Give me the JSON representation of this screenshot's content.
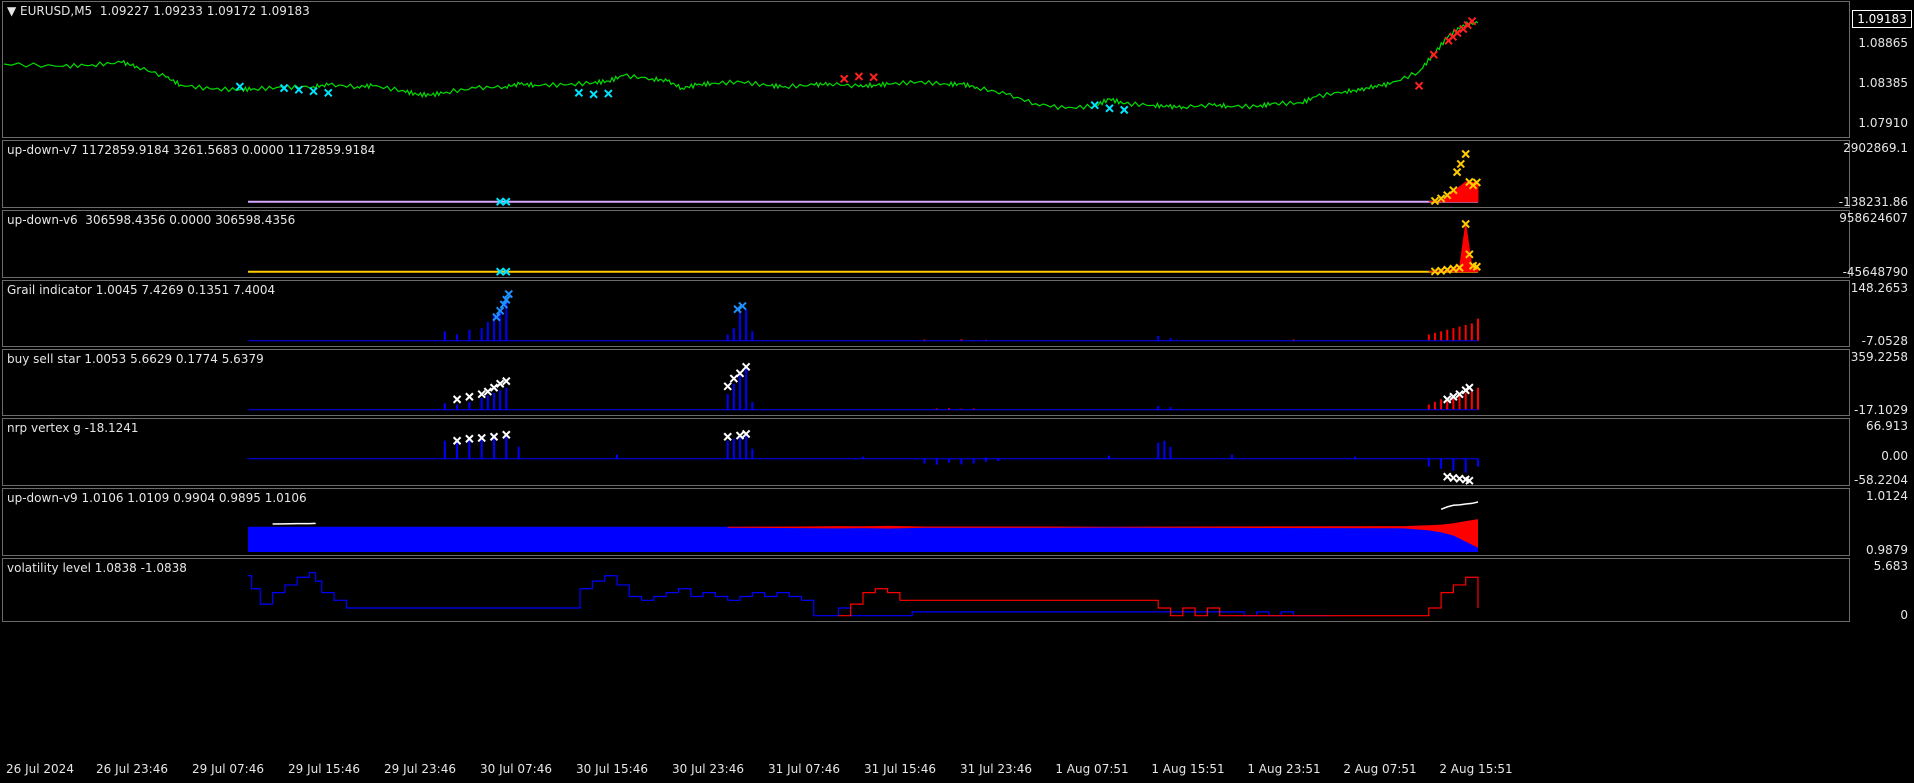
{
  "chart_data": [
    {
      "type": "line",
      "title": "EURUSD,M5  1.09227 1.09233 1.09172 1.09183",
      "symbol": "EURUSD",
      "timeframe": "M5",
      "ohlc": {
        "open": 1.09227,
        "high": 1.09233,
        "low": 1.09172,
        "close": 1.09183
      },
      "current_price": "1.09183",
      "price_ticks": [
        "1.09183",
        "1.08865",
        "1.08385",
        "1.07910"
      ],
      "ylim": [
        1.0775,
        1.0928
      ],
      "series": [
        {
          "name": "price",
          "color": "#00e000",
          "x": [
            0,
            4,
            6,
            8,
            9,
            11,
            12,
            14,
            16,
            17,
            19,
            21,
            22,
            24,
            25,
            27,
            28,
            29,
            30,
            32,
            34,
            35,
            36,
            38,
            40,
            41,
            42,
            44,
            45,
            46,
            47,
            48,
            50,
            52,
            53,
            55,
            56,
            58,
            59,
            60,
            62,
            64,
            65,
            66,
            68,
            70,
            72,
            74,
            75,
            76,
            78,
            79,
            80,
            82,
            83,
            85,
            86,
            88,
            89,
            91,
            92,
            93,
            94,
            96,
            97,
            98,
            99,
            100
          ],
          "y": [
            1.0865,
            1.0862,
            1.0864,
            1.0867,
            1.0862,
            1.0848,
            1.0838,
            1.0833,
            1.0832,
            1.0833,
            1.0835,
            1.0836,
            1.0838,
            1.0836,
            1.0837,
            1.0831,
            1.0826,
            1.0825,
            1.0829,
            1.0834,
            1.0836,
            1.0839,
            1.0838,
            1.0838,
            1.0841,
            1.0843,
            1.085,
            1.0846,
            1.0843,
            1.0834,
            1.0838,
            1.084,
            1.0842,
            1.0837,
            1.0836,
            1.0838,
            1.084,
            1.0836,
            1.0838,
            1.0839,
            1.0842,
            1.0839,
            1.0839,
            1.0835,
            1.0826,
            1.0814,
            1.0808,
            1.0811,
            1.082,
            1.0814,
            1.0812,
            1.081,
            1.081,
            1.0812,
            1.0811,
            1.081,
            1.0814,
            1.0815,
            1.0823,
            1.083,
            1.0831,
            1.0837,
            1.0839,
            1.0855,
            1.0878,
            1.0901,
            1.0915,
            1.0918
          ]
        }
      ],
      "markers": [
        {
          "color": "#00e5ff",
          "x": [
            16,
            19,
            20,
            21,
            22,
            39,
            40,
            41,
            74,
            75,
            76
          ],
          "y": [
            1.0836,
            1.0834,
            1.0832,
            1.083,
            1.0828,
            1.0828,
            1.0826,
            1.0827,
            1.0812,
            1.0808,
            1.0806
          ]
        },
        {
          "color": "#ff2020",
          "x": [
            57,
            58,
            59,
            96,
            97,
            98,
            98.3,
            98.6,
            99,
            99.3,
            99.6
          ],
          "y": [
            1.0846,
            1.0849,
            1.0848,
            1.0837,
            1.0877,
            1.0895,
            1.09,
            1.0905,
            1.091,
            1.0915,
            1.092
          ]
        }
      ]
    },
    {
      "type": "area",
      "title": "up-down-v7 1172859.9184 3261.5683 0.0000 1172859.9184",
      "scale_top": "2902869.1",
      "scale_bottom": "-138231.86",
      "ylim": [
        -138231.86,
        2902869.1
      ],
      "baseline": {
        "color": "#d8a8ff",
        "value": 0
      },
      "series": [
        {
          "name": "",
          "color": "#ff0000",
          "x": [
            96,
            97,
            97.5,
            98,
            98.5,
            99,
            99.5,
            100
          ],
          "y": [
            0,
            60000,
            250000,
            600000,
            900000,
            1200000,
            1172859.9184,
            1172859.9184
          ]
        }
      ],
      "markers": [
        {
          "color": "#00e5ff",
          "x": [
            20.5,
            21
          ],
          "y": [
            0,
            0
          ]
        },
        {
          "color": "#ffcc00",
          "x": [
            96.5,
            97,
            97.5,
            98,
            98.3,
            98.6,
            99,
            99.3,
            99.6,
            99.9
          ],
          "y": [
            50000,
            200000,
            400000,
            700000,
            1800000,
            2300000,
            2902869.1,
            1200000,
            1000000,
            1172859.9184
          ]
        }
      ]
    },
    {
      "type": "area",
      "title": "up-down-v6  306598.4356 0.0000 306598.4356",
      "scale_top": "958624607",
      "scale_bottom": "-45648790",
      "ylim": [
        -45648790,
        958624607
      ],
      "baseline": {
        "color": "#ffcc00",
        "value": 0
      },
      "series": [
        {
          "name": "",
          "color": "#ff0000",
          "x": [
            96,
            97,
            97.5,
            98,
            98.5,
            99,
            99.5,
            100
          ],
          "y": [
            0,
            10000000,
            30000000,
            60000000,
            80000000,
            958624607,
            100000000,
            80000000
          ]
        }
      ],
      "markers": [
        {
          "color": "#00e5ff",
          "x": [
            20.5,
            21
          ],
          "y": [
            0,
            0
          ]
        },
        {
          "color": "#ffcc00",
          "x": [
            96.5,
            97,
            97.5,
            98,
            98.5,
            99,
            99.3,
            99.6,
            99.9
          ],
          "y": [
            5000000,
            20000000,
            40000000,
            60000000,
            80000000,
            958624607,
            350000000,
            120000000,
            100000000
          ]
        }
      ]
    },
    {
      "type": "bar",
      "title": "Grail indicator 1.0045 7.4269 0.1351 7.4004",
      "scale_top": "148.2653",
      "scale_bottom": "-7.0528",
      "ylim": [
        -7.0528,
        148.2653
      ],
      "series": [
        {
          "name": "",
          "color": "#0000ff",
          "x": [
            16,
            17,
            18,
            19,
            19.5,
            20,
            20.5,
            21,
            39,
            39.5,
            40,
            40.5,
            41,
            74,
            75
          ],
          "y": [
            30,
            20,
            35,
            40,
            60,
            80,
            100,
            120,
            20,
            40,
            90,
            100,
            30,
            15,
            8
          ]
        },
        {
          "name": "",
          "color": "#ff0000",
          "x": [
            55,
            58,
            60,
            85,
            96,
            96.5,
            97,
            97.5,
            98,
            98.5,
            99,
            99.5,
            100
          ],
          "y": [
            4,
            5,
            3,
            4,
            20,
            25,
            30,
            35,
            40,
            45,
            50,
            55,
            70
          ]
        }
      ],
      "markers": [
        {
          "color": "#1e90ff",
          "x": [
            20.2,
            20.5,
            20.8,
            21,
            21.2,
            39.8,
            40.2
          ],
          "y": [
            75,
            95,
            115,
            130,
            148,
            100,
            110
          ]
        }
      ]
    },
    {
      "type": "bar",
      "title": "buy sell star 1.0053 5.6629 0.1774 5.6379",
      "scale_top": "359.2258",
      "scale_bottom": "-17.1029",
      "ylim": [
        -17.1029,
        359.2258
      ],
      "series": [
        {
          "name": "",
          "color": "#0000ff",
          "x": [
            16,
            17,
            18,
            19,
            19.5,
            20,
            20.5,
            21,
            39,
            39.5,
            40,
            40.5,
            41,
            74,
            75
          ],
          "y": [
            50,
            40,
            60,
            90,
            110,
            130,
            150,
            170,
            120,
            200,
            280,
            320,
            60,
            30,
            20
          ]
        },
        {
          "name": "",
          "color": "#ff0000",
          "x": [
            56,
            57,
            58,
            59,
            96,
            96.5,
            97,
            97.5,
            98,
            98.5,
            99,
            99.5,
            100
          ],
          "y": [
            10,
            12,
            8,
            10,
            40,
            60,
            80,
            90,
            100,
            110,
            130,
            150,
            170
          ]
        }
      ],
      "markers": [
        {
          "color": "#ffffff",
          "x": [
            17,
            18,
            19,
            19.5,
            20,
            20.5,
            21,
            39,
            39.5,
            40,
            40.5,
            97.5,
            98,
            98.5,
            99,
            99.3
          ],
          "y": [
            80,
            100,
            120,
            140,
            170,
            200,
            220,
            180,
            240,
            280,
            330,
            80,
            100,
            120,
            150,
            170
          ]
        }
      ]
    },
    {
      "type": "bar",
      "title": "nrp vertex g -18.1241",
      "scale_top": "66.913",
      "scale_mid": "0.00",
      "scale_bottom": "-58.2204",
      "ylim": [
        -58.2204,
        66.913
      ],
      "series": [
        {
          "name": "",
          "color": "#0000ff",
          "x": [
            0,
            16,
            17,
            18,
            19,
            20,
            21,
            22,
            30,
            39,
            39.5,
            40,
            40.5,
            41,
            50,
            60,
            70,
            74,
            74.5,
            75,
            80,
            90,
            96,
            97,
            98,
            99,
            100
          ],
          "y": [
            2,
            45,
            40,
            50,
            55,
            60,
            62,
            30,
            10,
            45,
            50,
            55,
            60,
            25,
            5,
            3,
            8,
            40,
            45,
            30,
            10,
            5,
            -20,
            -25,
            -30,
            -35,
            -20
          ]
        },
        {
          "name": "",
          "color": "#0000ff",
          "x": [
            55,
            56,
            57,
            58,
            59,
            60,
            61
          ],
          "y": [
            -12,
            -15,
            -10,
            -14,
            -12,
            -8,
            -6
          ]
        }
      ],
      "markers": [
        {
          "color": "#ffffff",
          "x": [
            17,
            18,
            19,
            20,
            21,
            39,
            40,
            40.5,
            97.5,
            98,
            98.5,
            99,
            99.3
          ],
          "y": [
            45,
            50,
            52,
            55,
            60,
            55,
            58,
            62,
            -45,
            -48,
            -50,
            -52,
            -55
          ]
        }
      ]
    },
    {
      "type": "area",
      "title": "up-down-v9 1.0106 1.0109 0.9904 0.9895 1.0106",
      "scale_top": "1.0124",
      "scale_bottom": "0.9879",
      "ylim": [
        0.9879,
        1.0124
      ],
      "series": [
        {
          "name": "",
          "color": "#0000ff",
          "x": [
            0,
            100
          ],
          "upper": [
            1.0003,
            1.0003
          ],
          "lower": [
            0.9879,
            0.9879
          ]
        },
        {
          "name": "",
          "color": "#ff0000",
          "x": [
            39,
            45,
            48,
            50,
            52,
            55,
            60,
            65,
            70,
            94,
            95,
            96,
            97,
            98,
            99,
            100
          ],
          "upper": [
            1.0003,
            1.0004,
            1.0006,
            1.0005,
            1.0007,
            1.0004,
            1.0004,
            1.0004,
            1.0003,
            1.0006,
            1.0008,
            1.001,
            1.0013,
            1.002,
            1.003,
            1.004
          ],
          "lower": [
            0.9998,
            0.9996,
            0.9995,
            0.9996,
            0.9994,
            0.9998,
            0.9998,
            0.9998,
            0.9999,
            0.9995,
            0.999,
            0.9985,
            0.9975,
            0.996,
            0.993,
            0.99
          ]
        }
      ],
      "white_line": {
        "color": "#ffffff",
        "x": [
          2,
          3,
          4,
          5,
          5.5,
          97,
          97.5,
          98,
          98.5,
          99,
          99.5,
          100
        ],
        "y": [
          1.0016,
          1.0017,
          1.0018,
          1.0018,
          1.0019,
          1.0088,
          1.01,
          1.0108,
          1.011,
          1.0114,
          1.0117,
          1.0124
        ]
      }
    },
    {
      "type": "line",
      "title": "volatility level 1.0838 -1.0838",
      "scale_top": "5.683",
      "scale_bottom": "0",
      "ylim": [
        -0.3,
        5.683
      ],
      "series": [
        {
          "name": "",
          "color": "#0000ff",
          "step": true,
          "x": [
            0,
            0.3,
            1,
            2,
            3,
            4,
            5,
            5.5,
            6,
            7,
            8,
            21,
            26,
            27,
            28,
            29,
            30,
            31,
            32,
            33,
            34,
            35,
            36,
            37,
            38,
            39,
            40,
            41,
            42,
            43,
            44,
            45,
            46,
            47,
            48,
            49,
            50,
            51,
            52,
            53,
            54,
            80,
            81,
            82,
            83,
            84,
            85,
            86,
            87,
            88
          ],
          "y": [
            5.2,
            3.5,
            1.5,
            3.0,
            4.0,
            5.0,
            5.6,
            4.5,
            3.0,
            2.0,
            1.0,
            1.0,
            1.0,
            3.5,
            4.5,
            5.2,
            4.0,
            2.5,
            2.0,
            2.5,
            3.0,
            3.5,
            2.5,
            3.0,
            2.5,
            2.0,
            2.5,
            3.0,
            2.5,
            3.0,
            2.5,
            2.0,
            0.0,
            0.0,
            1.0,
            0.0,
            0.0,
            0.0,
            0.0,
            0.0,
            0.5,
            0.5,
            0.0,
            0.5,
            0.0,
            0.5,
            0.0,
            0.0,
            0.0,
            0.0
          ]
        },
        {
          "name": "",
          "color": "#ff0000",
          "step": true,
          "x": [
            48,
            49,
            50,
            51,
            52,
            53,
            54,
            55,
            56,
            57,
            58,
            59,
            60,
            61,
            62,
            63,
            64,
            70,
            73,
            74,
            75,
            76,
            77,
            78,
            79,
            80,
            96,
            97,
            98,
            99,
            100
          ],
          "y": [
            0.0,
            1.5,
            3.0,
            3.5,
            3.0,
            2.0,
            2.0,
            2.0,
            2.0,
            2.0,
            2.0,
            2.0,
            2.0,
            2.0,
            2.0,
            2.0,
            2.0,
            2.0,
            2.0,
            1.0,
            0.0,
            1.0,
            0.0,
            1.0,
            0.0,
            0.0,
            1.0,
            3.0,
            4.0,
            5.0,
            1.0
          ]
        }
      ]
    }
  ],
  "time_axis": [
    "26 Jul 2024",
    "26 Jul 23:46",
    "29 Jul 07:46",
    "29 Jul 15:46",
    "29 Jul 23:46",
    "30 Jul 07:46",
    "30 Jul 15:46",
    "30 Jul 23:46",
    "31 Jul 07:46",
    "31 Jul 15:46",
    "31 Jul 23:46",
    "1 Aug 07:51",
    "1 Aug 15:51",
    "1 Aug 23:51",
    "2 Aug 07:51",
    "2 Aug 15:51"
  ]
}
